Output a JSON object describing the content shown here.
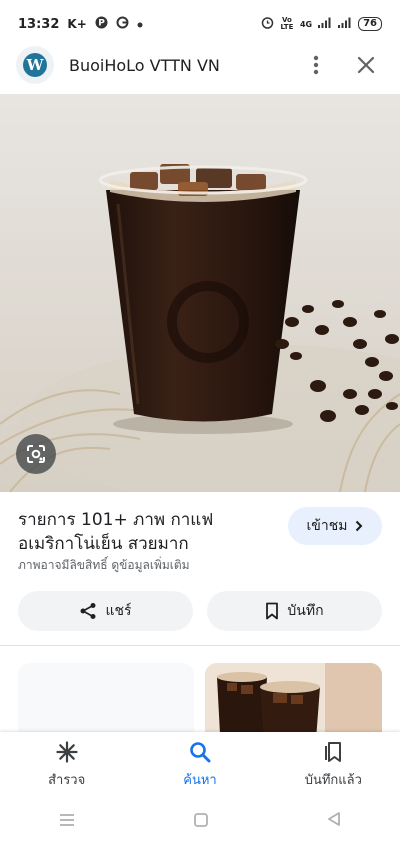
{
  "status_bar": {
    "time": "13:32",
    "left_icons": [
      "K+",
      "pinterest-icon",
      "google-icon",
      "dot-icon"
    ],
    "network": "4G",
    "volte": "Vo LTE",
    "battery": "76"
  },
  "header": {
    "logo_icon": "wordpress-icon",
    "site_name": "BuoiHoLo VTTN VN",
    "menu_icon": "more-vert-icon",
    "close_icon": "close-icon"
  },
  "result": {
    "title": "รายการ 101+ ภาพ กาแฟอเมริกาโน่เย็น สวยมาก",
    "visit_label": "เข้าชม",
    "subtext": "ภาพอาจมีลิขสิทธิ์ ดูข้อมูลเพิ่มเติม"
  },
  "actions": {
    "share_label": "แชร์",
    "save_label": "บันทึก"
  },
  "bottom_nav": {
    "items": [
      {
        "label": "สำรวจ",
        "icon": "asterisk-icon"
      },
      {
        "label": "ค้นหา",
        "icon": "search-icon"
      },
      {
        "label": "บันทึกแล้ว",
        "icon": "saved-collections-icon"
      }
    ],
    "active_index": 1
  },
  "colors": {
    "accent": "#1a73e8",
    "visit_bg": "#e8f0fe",
    "chip_bg": "#f1f3f4"
  }
}
